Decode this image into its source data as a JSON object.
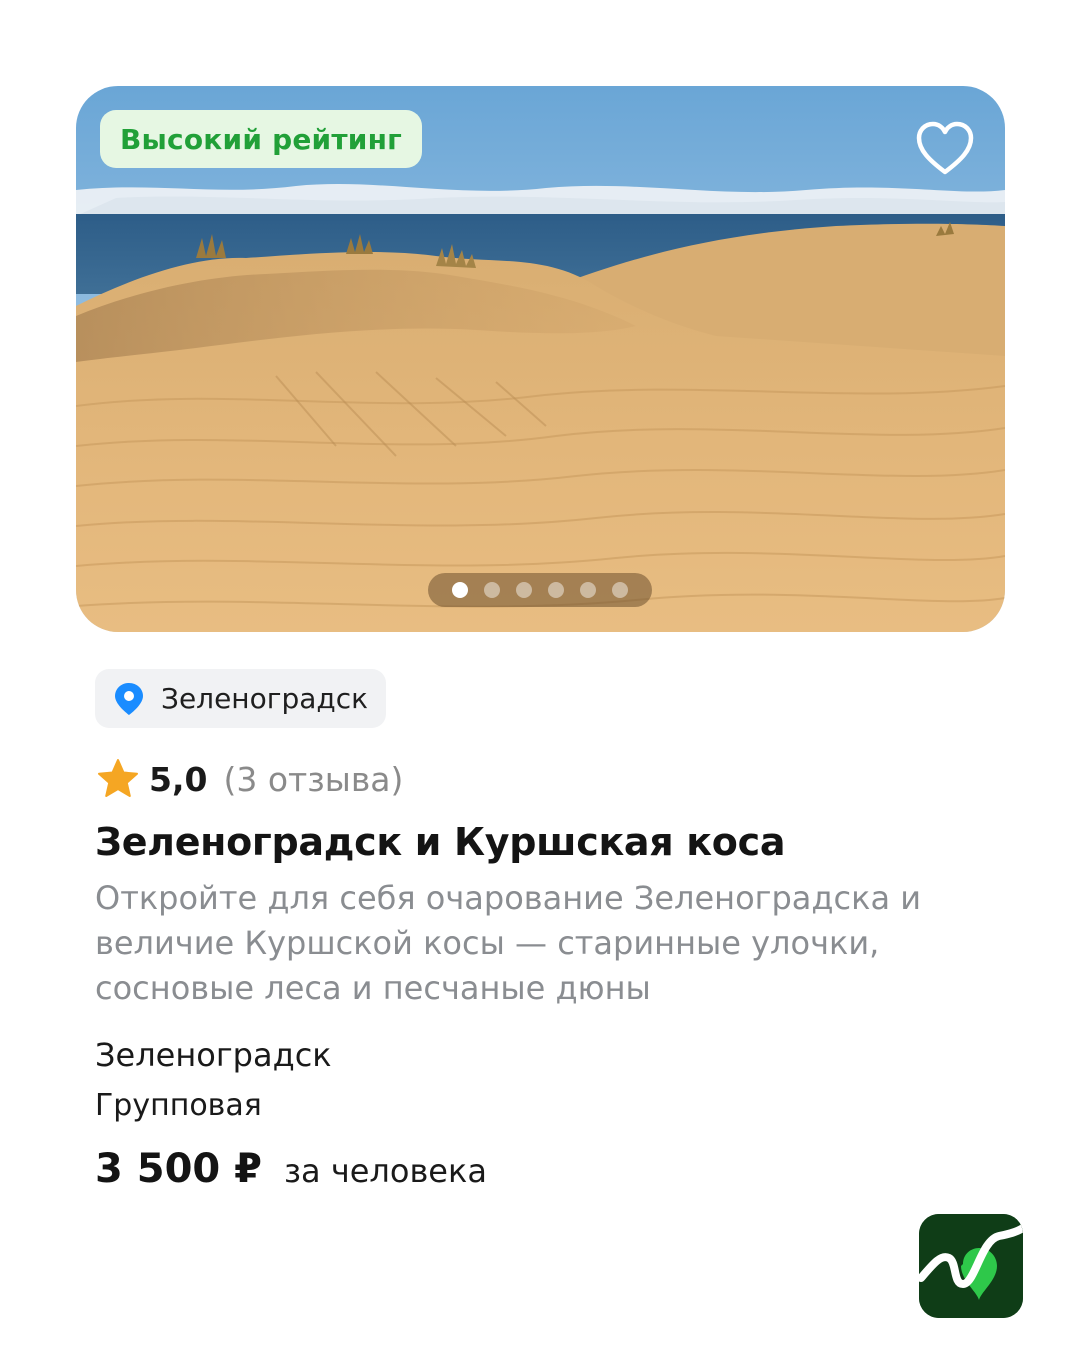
{
  "card": {
    "badge": "Высокий рейтинг",
    "image_count": 6,
    "active_image": 1,
    "location_chip": "Зеленоградск",
    "rating": "5,0",
    "reviews": "(3 отзыва)",
    "title": "Зеленоградск и Куршская коса",
    "description": "Откройте для себя очарование Зеленоградска и величие Куршской косы — старинные улочки, сосновые леса и песчаные дюны",
    "city": "Зеленоградск",
    "tour_type": "Групповая",
    "price": "3 500 ₽",
    "price_unit": "за человека"
  },
  "icons": {
    "favorite": "heart-outline-icon",
    "location": "map-pin-icon",
    "rating": "star-icon",
    "brand": "app-logo-icon"
  },
  "colors": {
    "badge_text": "#21a038",
    "badge_bg": "#e6f7e3",
    "pin": "#1a8cff",
    "star": "#f5a623",
    "logo_bg": "#0f3d17",
    "logo_accent": "#2ec84a"
  }
}
